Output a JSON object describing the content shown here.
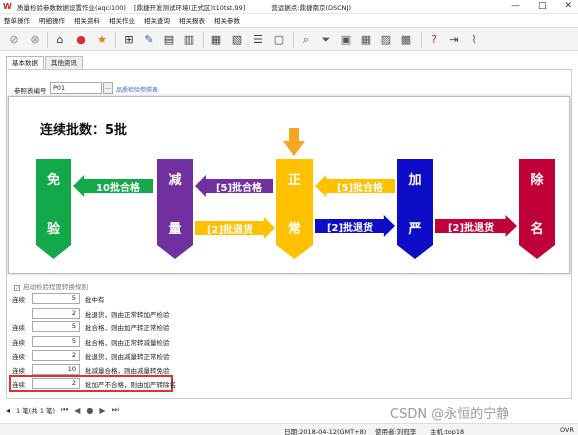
{
  "window": {
    "title": "质量检验参数数据设置作业(aqci100)",
    "env": "[鼎捷开发测试环境(正式区)t10tst,99]",
    "company": "营运据点:鼎捷南京(DSCNJ)",
    "controls": [
      "—",
      "□",
      "✕"
    ]
  },
  "menu": [
    "整单操作",
    "明细操作",
    "相关资料",
    "相关作业",
    "相关查询",
    "相关报表",
    "相关参数"
  ],
  "tabs": [
    "基本数据",
    "其他资讯"
  ],
  "form": {
    "field_label": "参照表编号",
    "field_value": "P01",
    "field_link": "品质检验参照表"
  },
  "diagram": {
    "title": "连续批数：5批",
    "nodes": [
      {
        "key": "mian",
        "top": "免",
        "bottom": "验",
        "color": "#13a84a"
      },
      {
        "key": "jian",
        "top": "减",
        "bottom": "量",
        "color": "#7030a0"
      },
      {
        "key": "zheng",
        "top": "正",
        "bottom": "常",
        "color": "#ffc000"
      },
      {
        "key": "jia",
        "top": "加",
        "bottom": "严",
        "color": "#0d0dc8"
      },
      {
        "key": "chu",
        "top": "除",
        "bottom": "名",
        "color": "#c00038"
      }
    ],
    "arrows": {
      "to_mian": "10批合格",
      "to_jian": "[5]批合格",
      "to_zheng_from_jia": "[5]批合格",
      "jian_to_zheng": "[2]批退货",
      "zheng_to_jia": "[2]批退货",
      "jia_to_chu": "[2]批退货"
    },
    "colors": {
      "green": "#13a84a",
      "purple": "#7030a0",
      "gold": "#ffc000",
      "blue": "#0d0dc8",
      "red": "#c00038"
    }
  },
  "rules": {
    "checkbox_label": "启动检验程度转换规则",
    "items": [
      {
        "label": "连续",
        "value": "5",
        "text": "批中有"
      },
      {
        "label": "",
        "value": "2",
        "text": "批退货，则由正常转加严检验"
      },
      {
        "label": "连续",
        "value": "5",
        "text": "批合格，则由加严转正常检验"
      },
      {
        "label": "连续",
        "value": "5",
        "text": "批合格，则由正常转减量检验"
      },
      {
        "label": "连续",
        "value": "2",
        "text": "批退货，则由减量转正常检验"
      },
      {
        "label": "连续",
        "value": "10",
        "text": "批减量合格，则由减量转免验"
      },
      {
        "label": "连续",
        "value": "2",
        "text": "批加严不合格，则由加严转除名"
      }
    ]
  },
  "navigation": {
    "label": "1 笔(共 1 笔)"
  },
  "status": {
    "date": "日期:2018-04-12(GMT+8)",
    "user": "使用者:刘冠李",
    "host": "主机:top18",
    "mode": "OVR"
  },
  "watermark": "CSDN @永恒的宁静"
}
